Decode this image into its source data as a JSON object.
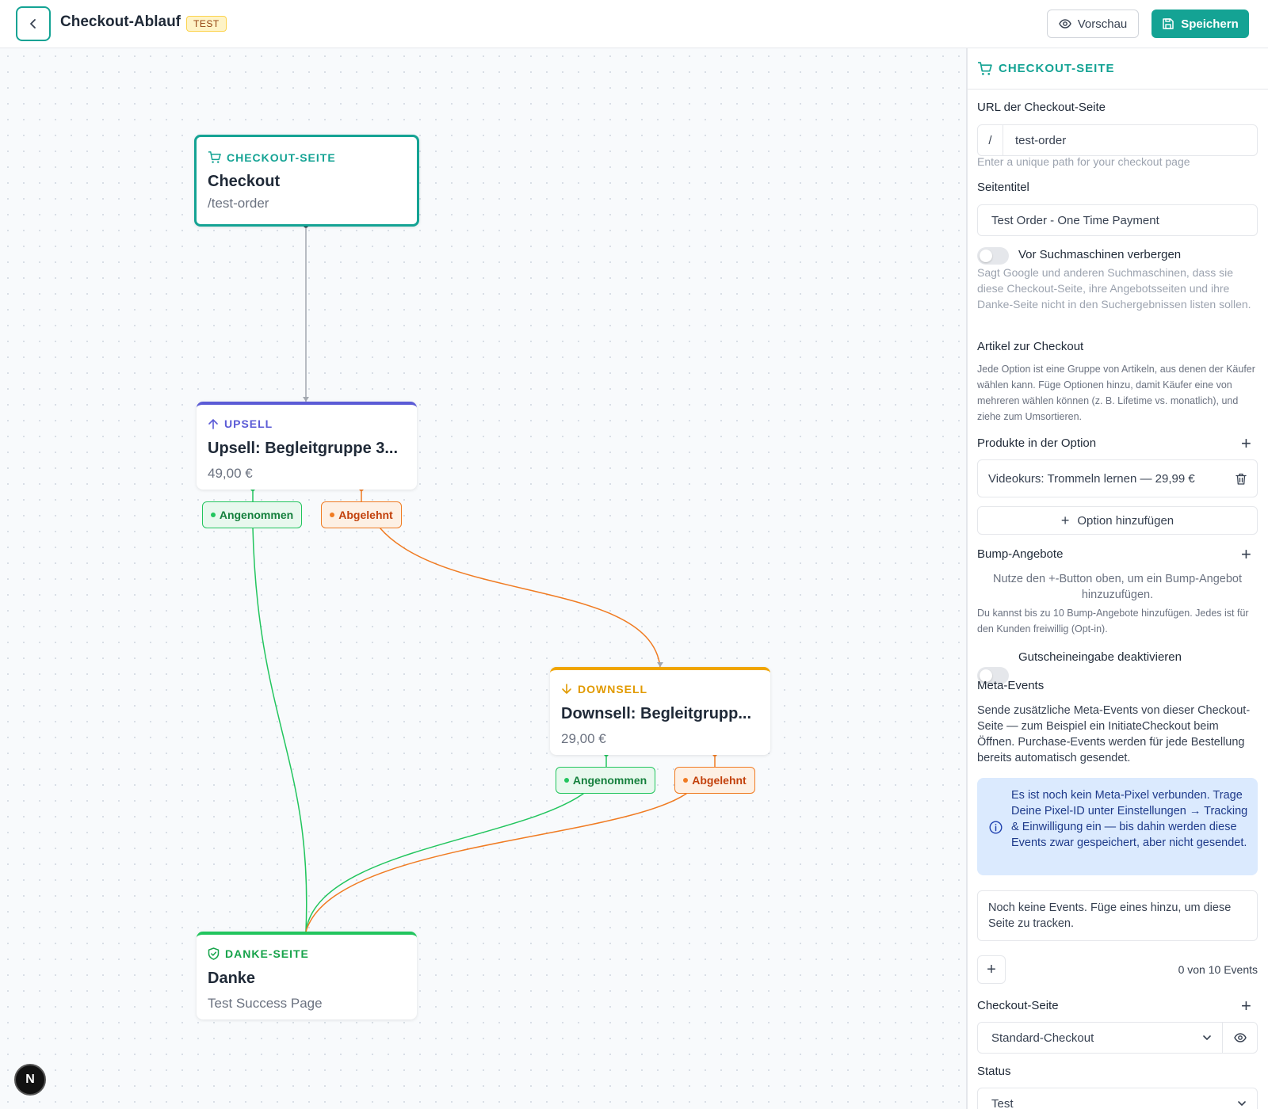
{
  "header": {
    "title": "Checkout-Ablauf",
    "badge": "TEST",
    "preview_label": "Vorschau",
    "save_label": "Speichern"
  },
  "canvas": {
    "nodes": {
      "checkout": {
        "type": "CHECKOUT-SEITE",
        "title": "Checkout",
        "sub": "/test-order"
      },
      "upsell": {
        "type": "UPSELL",
        "title": "Upsell: Begleitgruppe 3...",
        "sub": "49,00 €"
      },
      "downsell": {
        "type": "DOWNSELL",
        "title": "Downsell: Begleitgrupp...",
        "sub": "29,00 €"
      },
      "danke": {
        "type": "DANKE-SEITE",
        "title": "Danke",
        "sub": "Test Success Page"
      }
    },
    "edge_labels": {
      "accepted": "Angenommen",
      "declined": "Abgelehnt"
    },
    "logo": "N"
  },
  "panel": {
    "header": "CHECKOUT-SEITE",
    "url_label": "URL der Checkout-Seite",
    "url_prefix": "/",
    "url_value": "test-order",
    "url_hint": "Enter a unique path for your checkout page",
    "title_label": "Seitentitel",
    "title_value": "Test Order - One Time Payment",
    "hide_label": "Vor Suchmaschinen verbergen",
    "hide_hint": "Sagt Google und anderen Suchmaschinen, dass sie diese Checkout-Seite, ihre Angebotsseiten und ihre Danke-Seite nicht in den Suchergebnissen listen sollen.",
    "items_label": "Artikel zur Checkout",
    "items_desc": "Jede Option ist eine Gruppe von Artikeln, aus denen der Käufer wählen kann. Füge Optionen hinzu, damit Käufer eine von mehreren wählen können (z. B. Lifetime vs. monatlich), und ziehe zum Umsortieren.",
    "products_label": "Produkte in der Option",
    "product_item": "Videokurs: Trommeln lernen — 29,99 €",
    "add_option": "Option hinzufügen",
    "bump_label": "Bump-Angebote",
    "bump_empty": "Nutze den +-Button oben, um ein Bump-Angebot hinzuzufügen.",
    "bump_hint": "Du kannst bis zu 10 Bump-Angebote hinzufügen. Jedes ist für den Kunden freiwillig (Opt-in).",
    "coupon_label": "Gutscheineingabe deaktivieren",
    "meta_label": "Meta-Events",
    "meta_desc": "Sende zusätzliche Meta-Events von dieser Checkout-Seite — zum Beispiel ein InitiateCheckout beim Öffnen. Purchase-Events werden für jede Bestellung bereits automatisch gesendet.",
    "meta_info": "Es ist noch kein Meta-Pixel verbunden. Trage Deine Pixel-ID unter Einstellungen → Tracking & Einwilligung ein — bis dahin werden diese Events zwar gespeichert, aber nicht gesendet.",
    "no_events": "Noch keine Events. Füge eines hinzu, um diese Seite zu tracken.",
    "events_count": "0 von 10 Events",
    "checkout_page_label": "Checkout-Seite",
    "checkout_page_value": "Standard-Checkout",
    "status_label": "Status",
    "status_value": "Test"
  },
  "colors": {
    "accent": "#14a394",
    "upsell": "#5b5bd6",
    "downsell": "#f0a500",
    "thanks": "#22c55e",
    "accepted": "#22c55e",
    "declined": "#f07b22"
  }
}
